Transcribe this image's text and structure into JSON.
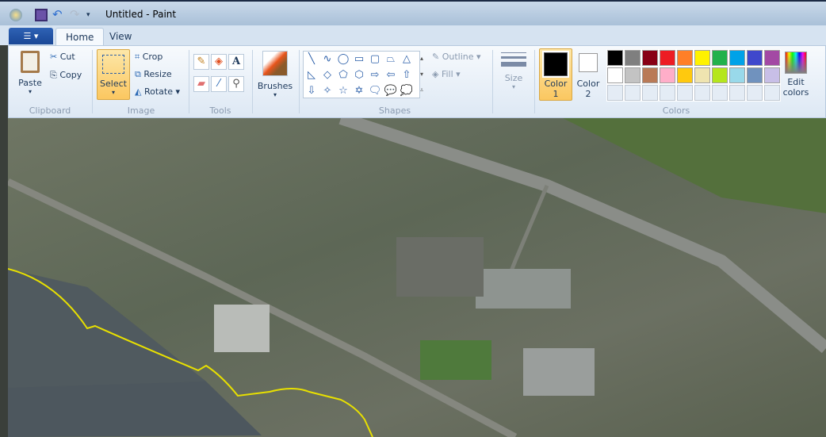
{
  "window": {
    "title": "Untitled - Paint"
  },
  "tabs": [
    {
      "label": "Home"
    },
    {
      "label": "View"
    }
  ],
  "clipboard": {
    "paste": "Paste",
    "cut": "Cut",
    "copy": "Copy",
    "group": "Clipboard"
  },
  "image": {
    "select": "Select",
    "crop": "Crop",
    "resize": "Resize",
    "rotate": "Rotate",
    "group": "Image"
  },
  "tools": {
    "group": "Tools",
    "items": [
      "pencil-icon",
      "fill-icon",
      "text-icon",
      "eraser-icon",
      "color-picker-icon",
      "magnifier-icon"
    ]
  },
  "brushes": {
    "label": "Brushes"
  },
  "shapes": {
    "group": "Shapes",
    "outline": "Outline",
    "fill": "Fill",
    "glyphs": [
      "╲",
      "∿",
      "◯",
      "▭",
      "▢",
      "⏢",
      "△",
      "◺",
      "◇",
      "⬠",
      "⬡",
      "⇨",
      "⇦",
      "⇧",
      "⇩",
      "✧",
      "☆",
      "✡",
      "🗨",
      "💬",
      "💭"
    ]
  },
  "size": {
    "label": "Size"
  },
  "colors": {
    "group": "Colors",
    "color1": "Color\n1",
    "color1_a": "Color",
    "color1_b": "1",
    "color2_a": "Color",
    "color2_b": "2",
    "edit_a": "Edit",
    "edit_b": "colors",
    "color1_value": "#000000",
    "color2_value": "#ffffff",
    "row1": [
      "#000000",
      "#7f7f7f",
      "#880015",
      "#ed1c24",
      "#ff7f27",
      "#fff200",
      "#22b14c",
      "#00a2e8",
      "#3f48cc",
      "#a349a4"
    ],
    "row2": [
      "#ffffff",
      "#c3c3c3",
      "#b97a57",
      "#ffaec9",
      "#ffc90e",
      "#efe4b0",
      "#b5e61d",
      "#99d9ea",
      "#7092be",
      "#c8bfe7"
    ]
  }
}
